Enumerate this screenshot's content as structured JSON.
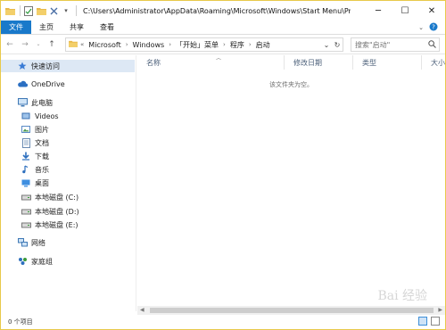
{
  "window": {
    "title": "C:\\Users\\Administrator\\AppData\\Roaming\\Microsoft\\Windows\\Start Menu\\Progra...",
    "controls": [
      "─",
      "☐",
      "✕"
    ]
  },
  "ribbon": {
    "tabs": [
      "文件",
      "主页",
      "共享",
      "查看"
    ]
  },
  "address": {
    "crumbs": [
      "Microsoft",
      "Windows",
      "「开始」菜单",
      "程序",
      "启动"
    ],
    "search_placeholder": "搜索\"启动\""
  },
  "sidebar": {
    "items": [
      {
        "label": "快速访问",
        "icon": "star-icon"
      },
      {
        "label": "OneDrive",
        "icon": "cloud-icon"
      },
      {
        "label": "此电脑",
        "icon": "computer-icon"
      },
      {
        "label": "Videos",
        "icon": "video-icon"
      },
      {
        "label": "图片",
        "icon": "picture-icon"
      },
      {
        "label": "文档",
        "icon": "document-icon"
      },
      {
        "label": "下载",
        "icon": "download-icon"
      },
      {
        "label": "音乐",
        "icon": "music-icon"
      },
      {
        "label": "桌面",
        "icon": "desktop-icon"
      },
      {
        "label": "本地磁盘 (C:)",
        "icon": "drive-icon"
      },
      {
        "label": "本地磁盘 (D:)",
        "icon": "drive-icon"
      },
      {
        "label": "本地磁盘 (E:)",
        "icon": "drive-icon"
      },
      {
        "label": "网络",
        "icon": "network-icon"
      },
      {
        "label": "家庭组",
        "icon": "homegroup-icon"
      }
    ]
  },
  "columns": [
    "名称",
    "修改日期",
    "类型",
    "大小"
  ],
  "empty_message": "该文件夹为空。",
  "status": {
    "item_count": "0 个项目"
  },
  "watermark": "Bai 经验",
  "colors": {
    "accent": "#1979ca",
    "selected": "#dde8f5",
    "frame": "#e8c94a"
  }
}
